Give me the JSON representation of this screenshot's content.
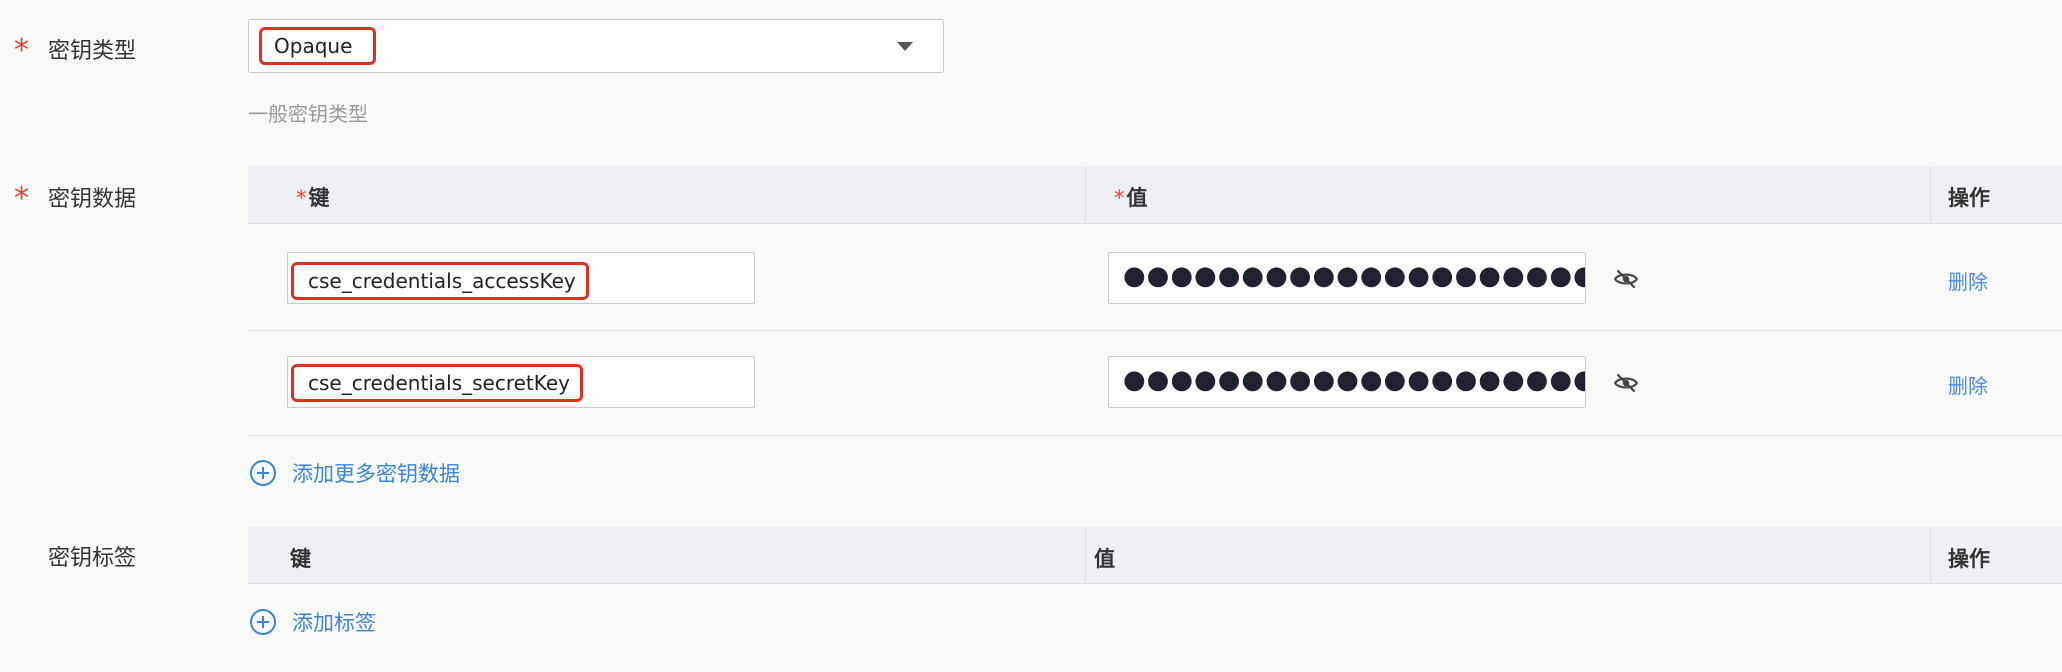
{
  "secret_type": {
    "label": "密钥类型",
    "required_mark": "*",
    "selected": "Opaque",
    "hint": "一般密钥类型"
  },
  "secret_data": {
    "label": "密钥数据",
    "required_mark": "*",
    "columns": {
      "key": "键",
      "value": "值",
      "action": "操作",
      "required_mark": "*"
    },
    "rows": [
      {
        "key": "cse_credentials_accessKey",
        "value_masked": "●●●●●●●●●●●●●●●●●●●●",
        "action": "删除"
      },
      {
        "key": "cse_credentials_secretKey",
        "value_masked": "●●●●●●●●●●●●●●●●●●●●",
        "action": "删除"
      }
    ],
    "add_label": "添加更多密钥数据"
  },
  "secret_labels": {
    "label": "密钥标签",
    "columns": {
      "key": "键",
      "value": "值",
      "action": "操作"
    },
    "add_label": "添加标签"
  },
  "colors": {
    "required": "#e0413a",
    "link": "#4a8bdc",
    "highlight_box": "#d9341f",
    "table_header": "#eef0f5"
  }
}
